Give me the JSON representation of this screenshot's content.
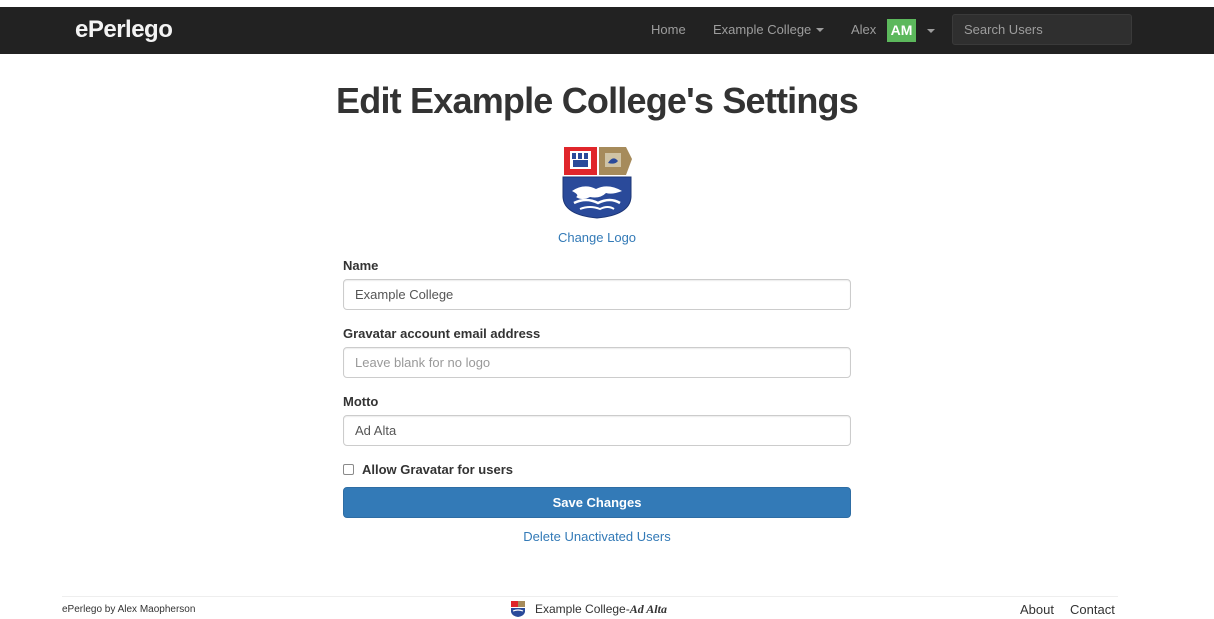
{
  "navbar": {
    "brand": "ePerlego",
    "home": "Home",
    "college": "Example College",
    "user": "Alex",
    "avatar_initials": "AM",
    "search_placeholder": "Search Users"
  },
  "page": {
    "title": "Edit Example College's Settings",
    "change_logo": "Change Logo"
  },
  "form": {
    "name_label": "Name",
    "name_value": "Example College",
    "email_label": "Gravatar account email address",
    "email_placeholder": "Leave blank for no logo",
    "motto_label": "Motto",
    "motto_value": "Ad Alta",
    "allow_gravatar_label": "Allow Gravatar for users",
    "allow_gravatar_checked": false,
    "save_label": "Save Changes",
    "delete_link": "Delete Unactivated Users"
  },
  "footer": {
    "credit": "ePerlego by Alex Maopherson",
    "college": "Example College",
    "separator": " - ",
    "motto": "Ad Alta",
    "about": "About",
    "contact": "Contact"
  },
  "colors": {
    "navbar_bg": "#222222",
    "primary": "#337ab7",
    "avatar_bg": "#5cb85c",
    "crest_red": "#e0262b",
    "crest_blue": "#2a4a9a",
    "crest_tan": "#a68b5b"
  }
}
